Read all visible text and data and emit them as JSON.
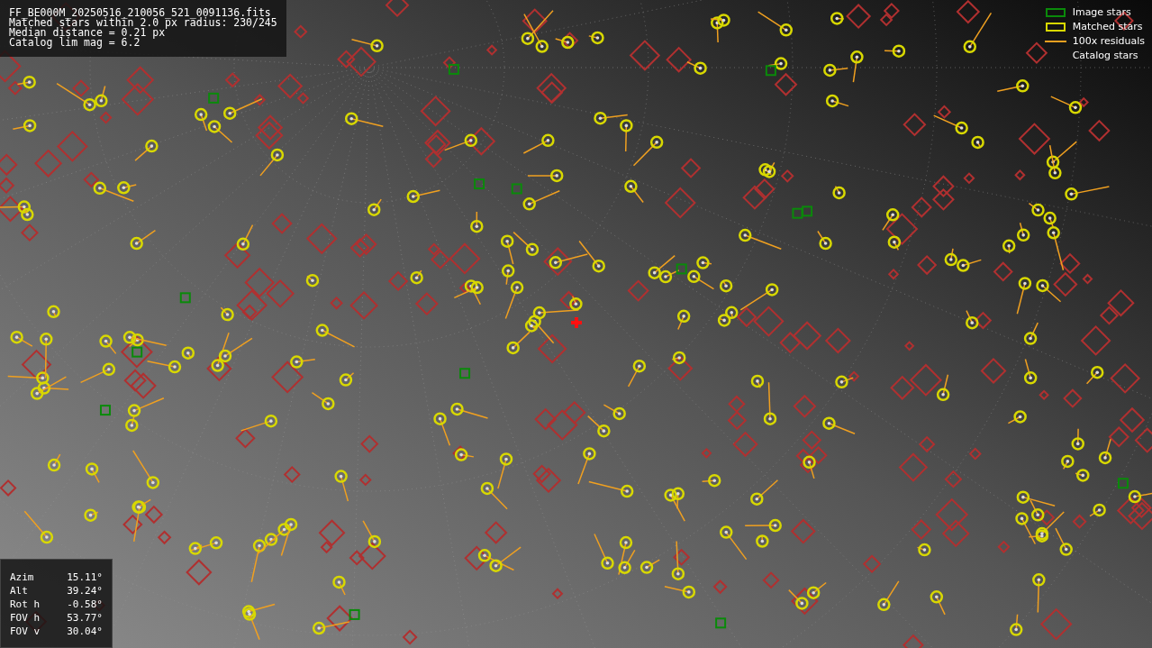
{
  "info_box": {
    "lines": [
      "FF_BE000M_20250516_210056_521_0091136.fits",
      "Matched stars within 2.0 px radius: 230/245",
      "Median distance = 0.21 px",
      "Catalog lim mag = 6.2"
    ]
  },
  "legend": {
    "items": [
      {
        "kind": "image",
        "label": "Image stars"
      },
      {
        "kind": "matched",
        "label": "Matched stars"
      },
      {
        "kind": "residual",
        "label": "100x residuals"
      },
      {
        "kind": "catalog",
        "label": "Catalog stars"
      }
    ]
  },
  "pointing": {
    "rows": [
      {
        "label": "Azim",
        "value": "15.11°"
      },
      {
        "label": "Alt",
        "value": "39.24°"
      },
      {
        "label": "Rot h",
        "value": "-0.58°"
      },
      {
        "label": "FOV h",
        "value": "53.77°"
      },
      {
        "label": "FOV v",
        "value": "30.04°"
      }
    ]
  }
}
